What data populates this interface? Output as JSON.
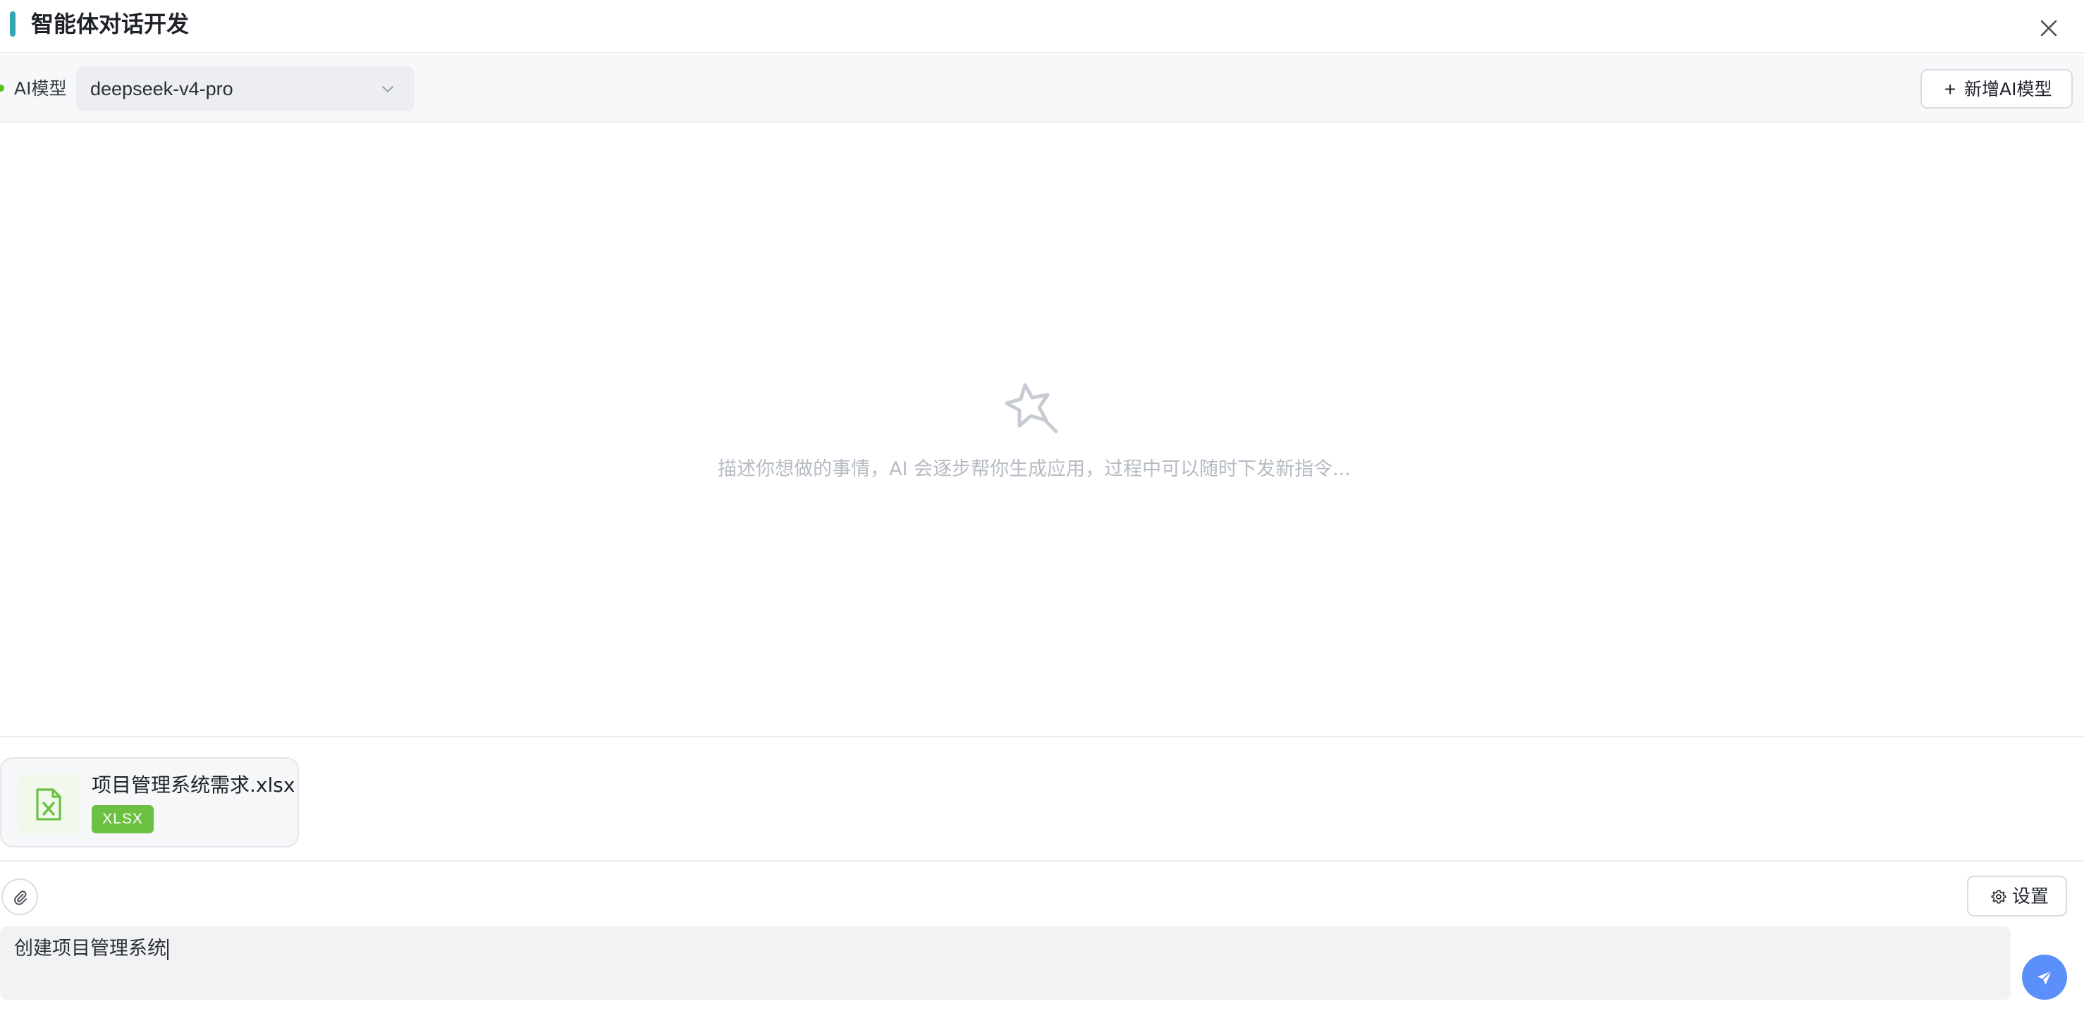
{
  "header": {
    "title": "智能体对话开发",
    "accent_color": "#36a6b4",
    "close_icon": "close-icon"
  },
  "toolbar": {
    "model_label": "AI模型",
    "model_status_color": "#52c41a",
    "selected_model": "deepseek-v4-pro",
    "add_model_plus": "+",
    "add_model_label": "新增AI模型"
  },
  "empty_state": {
    "icon": "magic-wand-star-icon",
    "hint": "描述你想做的事情，AI 会逐步帮你生成应用，过程中可以随时下发新指令..."
  },
  "attachments": [
    {
      "file_name": "项目管理系统需求.xlsx",
      "file_type": "XLSX",
      "icon": "excel-file-icon",
      "badge_color": "#6cc142"
    }
  ],
  "composer": {
    "attach_icon": "paperclip-icon",
    "settings_label": "设置",
    "settings_icon": "gear-icon",
    "input_value": "创建项目管理系统",
    "send_icon": "send-icon",
    "send_color": "#5b8ff9"
  }
}
